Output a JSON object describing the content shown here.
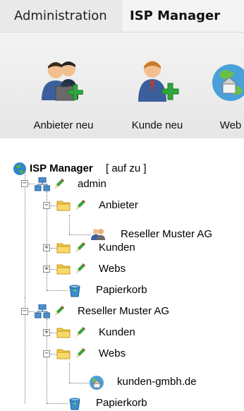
{
  "tabs": [
    {
      "label": "Administration"
    },
    {
      "label": "ISP Manager",
      "active": true
    }
  ],
  "toolbar": {
    "buttons": [
      {
        "label": "Anbieter neu",
        "icon": "users-add-icon"
      },
      {
        "label": "Kunde neu",
        "icon": "user-add-icon"
      },
      {
        "label": "Web",
        "icon": "web-globe-icon"
      }
    ]
  },
  "tree": {
    "root": {
      "label": "ISP Manager",
      "actions": "[ auf  zu ]"
    },
    "admin": {
      "label": "admin"
    },
    "anbieter": {
      "label": "Anbieter"
    },
    "reseller_child": {
      "label": "Reseller Muster AG"
    },
    "kunden1": {
      "label": "Kunden"
    },
    "webs1": {
      "label": "Webs"
    },
    "papierkorb1": {
      "label": "Papierkorb"
    },
    "reseller": {
      "label": "Reseller Muster AG"
    },
    "kunden2": {
      "label": "Kunden"
    },
    "webs2": {
      "label": "Webs"
    },
    "domain": {
      "label": "kunden-gmbh.de"
    },
    "papierkorb2": {
      "label": "Papierkorb"
    }
  },
  "colors": {
    "tabbar_bg": "#e9e9e9",
    "active_tab_bg": "#f4f4f4",
    "folder": "#f2c84b",
    "pencil": "#3aa23a",
    "trash": "#3a8ed0"
  }
}
